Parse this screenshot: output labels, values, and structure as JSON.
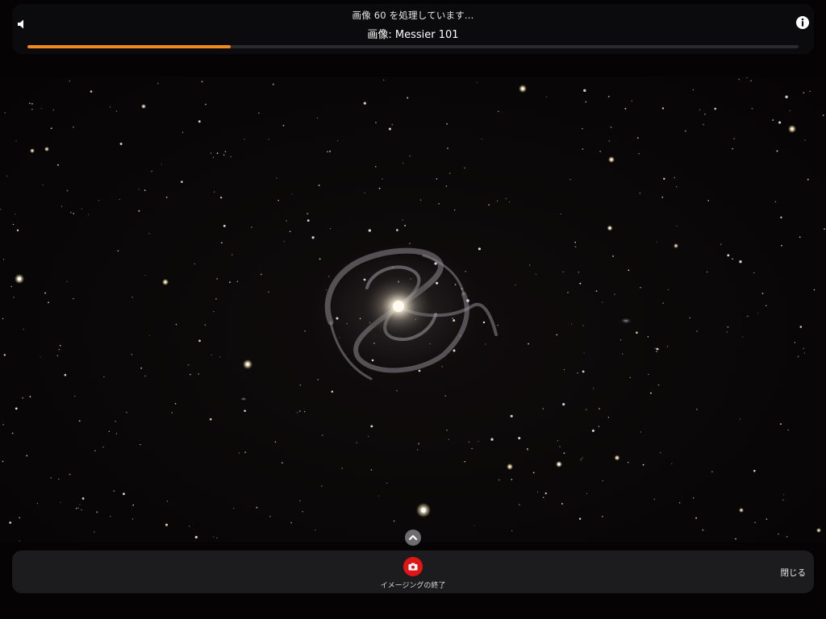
{
  "top_panel": {
    "processing_text": "画像 60 を処理しています...",
    "image_label": "画像: Messier 101",
    "progress_fraction": 0.264,
    "progress_color": "#f08a1c",
    "left_icon": "speaker-icon",
    "right_icon": "info-icon"
  },
  "bottom_bar": {
    "stop_label": "イメージングの終了",
    "stop_icon": "camera-icon",
    "stop_color": "#e01616",
    "close_label": "閉じる"
  },
  "expand_icon": "chevron-up-icon"
}
